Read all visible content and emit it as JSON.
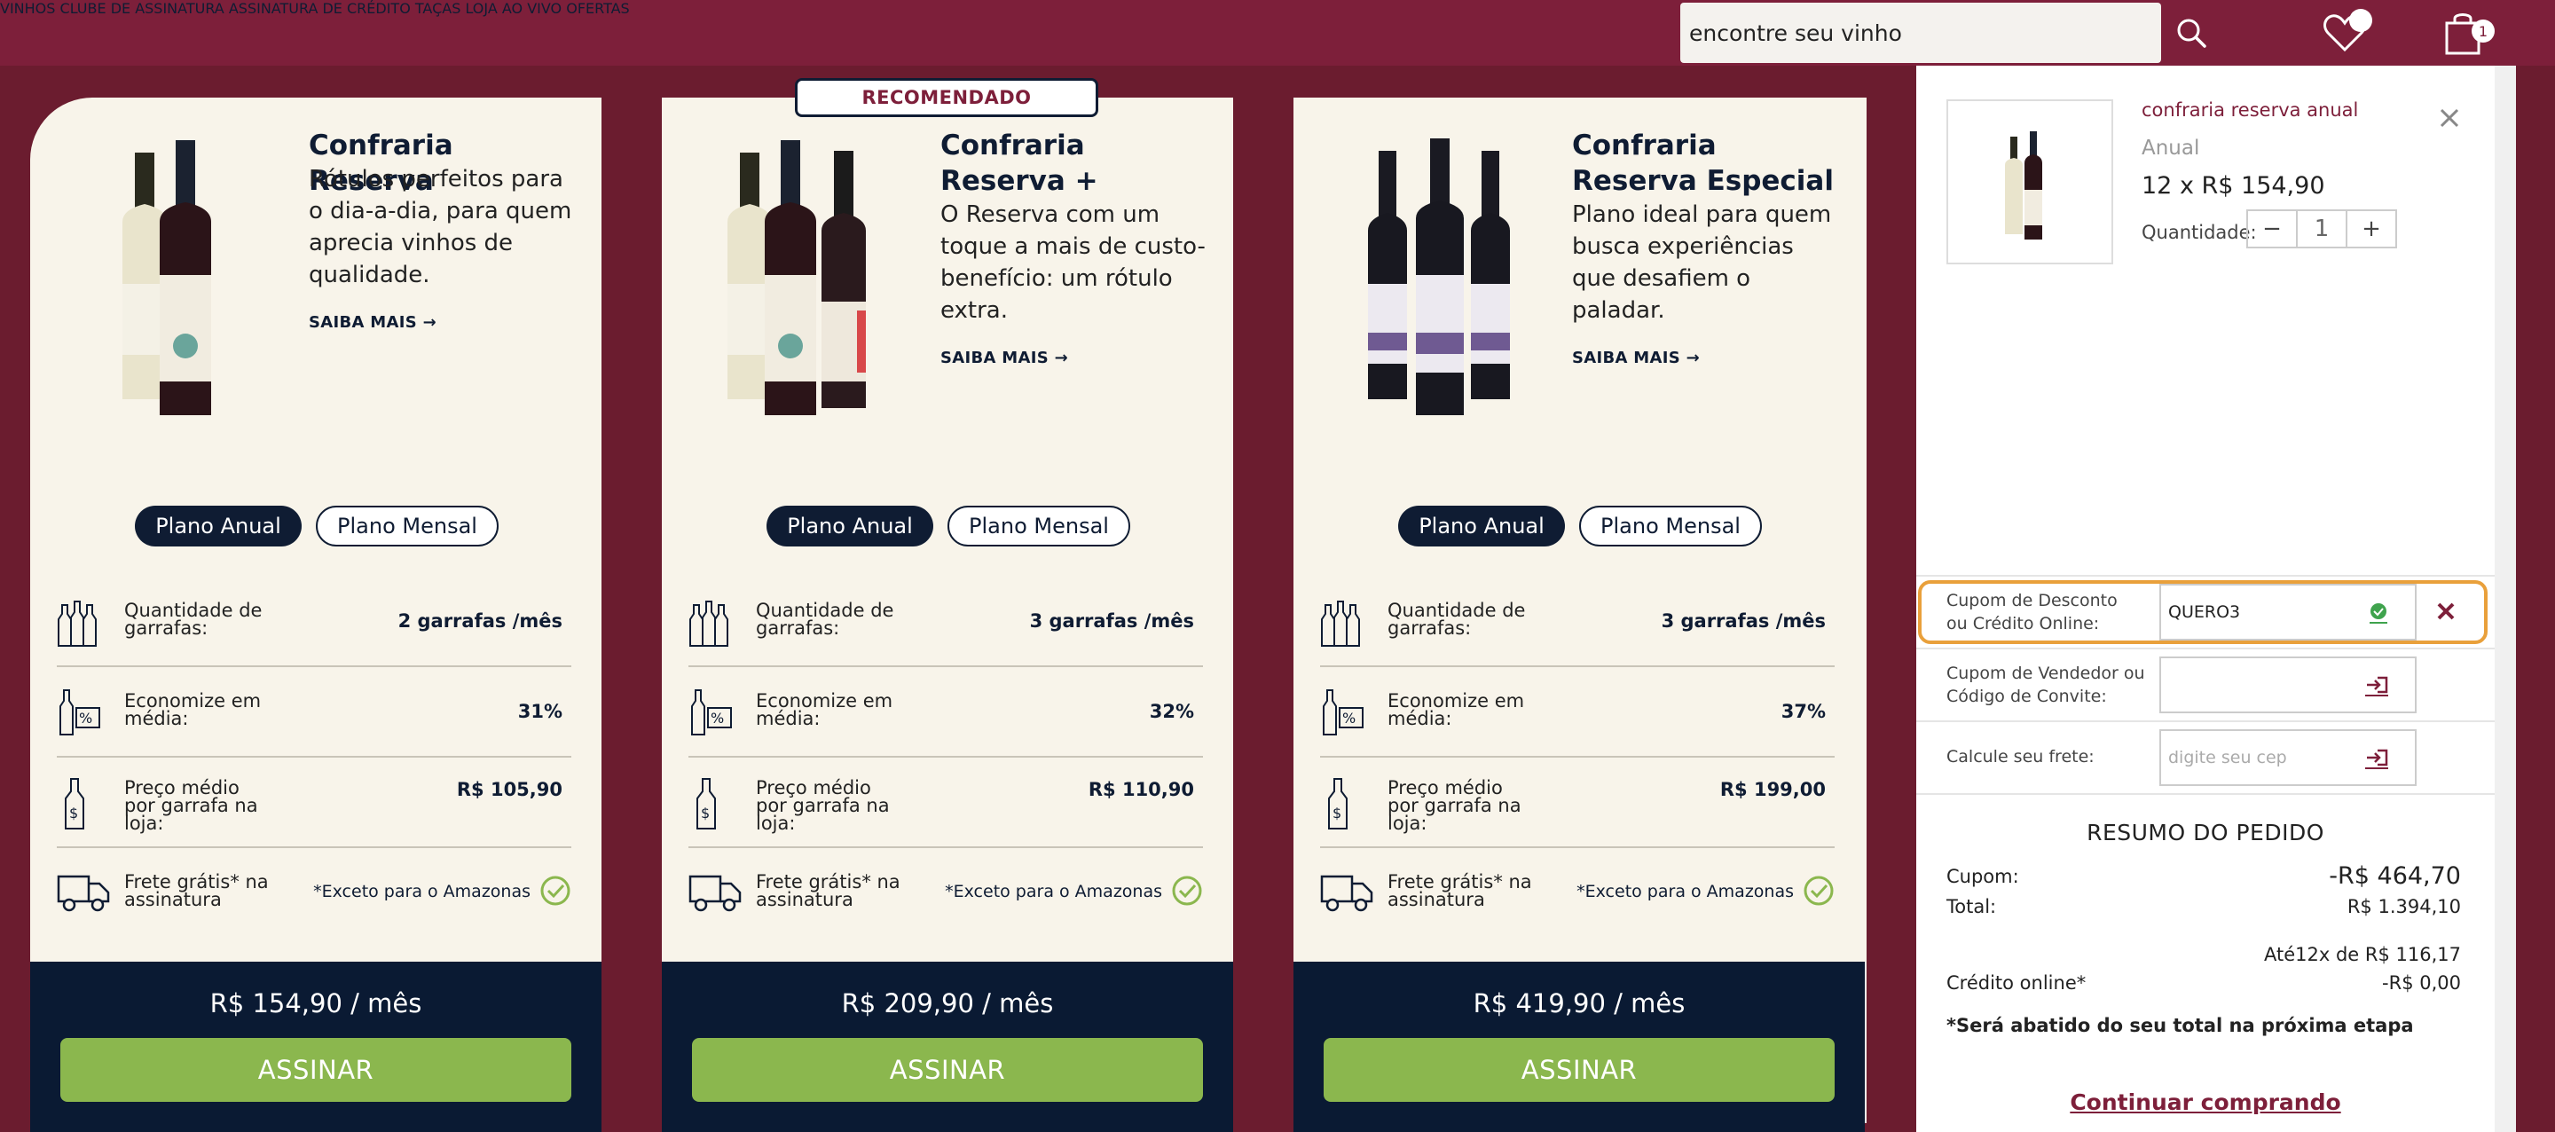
{
  "nav": {
    "items": [
      "VINHOS",
      "CLUBE DE ASSINATURA",
      "ASSINATURA DE CRÉDITO",
      "TAÇAS",
      "LOJA AO VIVO",
      "OFERTAS"
    ],
    "search_value": "encontre seu vinho",
    "cart_count": "1"
  },
  "recomendado": "RECOMENDADO",
  "cards": [
    {
      "title": "Confraria Reserva",
      "desc": "Rótulos perfeitos para o dia-a-dia, para quem aprecia vinhos de qualidade.",
      "more": "SAIBA MAIS →",
      "plan_anual": "Plano Anual",
      "plan_mensal": "Plano Mensal",
      "qty_label": "Quantidade de garrafas:",
      "qty_value": "2 garrafas /mês",
      "eco_label": "Economize em média:",
      "eco_value": "31%",
      "preco_label": "Preço médio por garrafa na loja:",
      "preco_value": "R$ 105,90",
      "frete_label": "Frete grátis* na assinatura",
      "frete_note": "*Exceto para o Amazonas",
      "price": "R$ 154,90 / mês",
      "cta": "ASSINAR"
    },
    {
      "title": "Confraria Reserva +",
      "desc": "O Reserva com um toque a mais de custo-benefício: um rótulo extra.",
      "more": "SAIBA MAIS →",
      "plan_anual": "Plano Anual",
      "plan_mensal": "Plano Mensal",
      "qty_label": "Quantidade de garrafas:",
      "qty_value": "3 garrafas /mês",
      "eco_label": "Economize em média:",
      "eco_value": "32%",
      "preco_label": "Preço médio por garrafa na loja:",
      "preco_value": "R$ 110,90",
      "frete_label": "Frete grátis* na assinatura",
      "frete_note": "*Exceto para o Amazonas",
      "price": "R$ 209,90 / mês",
      "cta": "ASSINAR"
    },
    {
      "title": "Confraria Reserva Especial",
      "desc": "Plano ideal para quem busca experiências que desafiem o paladar.",
      "more": "SAIBA MAIS →",
      "plan_anual": "Plano Anual",
      "plan_mensal": "Plano Mensal",
      "qty_label": "Quantidade de garrafas:",
      "qty_value": "3 garrafas /mês",
      "eco_label": "Economize em média:",
      "eco_value": "37%",
      "preco_label": "Preço médio por garrafa na loja:",
      "preco_value": "R$ 199,00",
      "frete_label": "Frete grátis* na assinatura",
      "frete_note": "*Exceto para o Amazonas",
      "price": "R$ 419,90 / mês",
      "cta": "ASSINAR"
    }
  ],
  "cart": {
    "product_name": "confraria reserva anual",
    "product_type": "Anual",
    "product_price": "12 x R$ 154,90",
    "qty_label": "Quantidade:",
    "qty_minus": "−",
    "qty_value": "1",
    "qty_plus": "+",
    "coupon_label": "Cupom de Desconto ou Crédito Online:",
    "coupon_value": "QUERO3",
    "seller_label": "Cupom de Vendedor ou Código de Convite:",
    "seller_value": "",
    "frete_label": "Calcule seu frete:",
    "frete_placeholder": "digite seu cep",
    "summary_title": "RESUMO DO PEDIDO",
    "cupom_label": "Cupom:",
    "cupom_value": "-R$ 464,70",
    "total_label": "Total:",
    "total_value": "R$ 1.394,10",
    "installments": "Até12x de R$ 116,17",
    "credito_label": "Crédito online*",
    "credito_value": "-R$ 0,00",
    "note": "*Será abatido do seu total na próxima etapa",
    "continue": "Continuar comprando"
  },
  "colors": {
    "brand": "#7d1f3a",
    "navy": "#0f1c33",
    "green": "#8bb74e",
    "cream": "#f8f4ea",
    "highlight": "#e9a03b"
  }
}
